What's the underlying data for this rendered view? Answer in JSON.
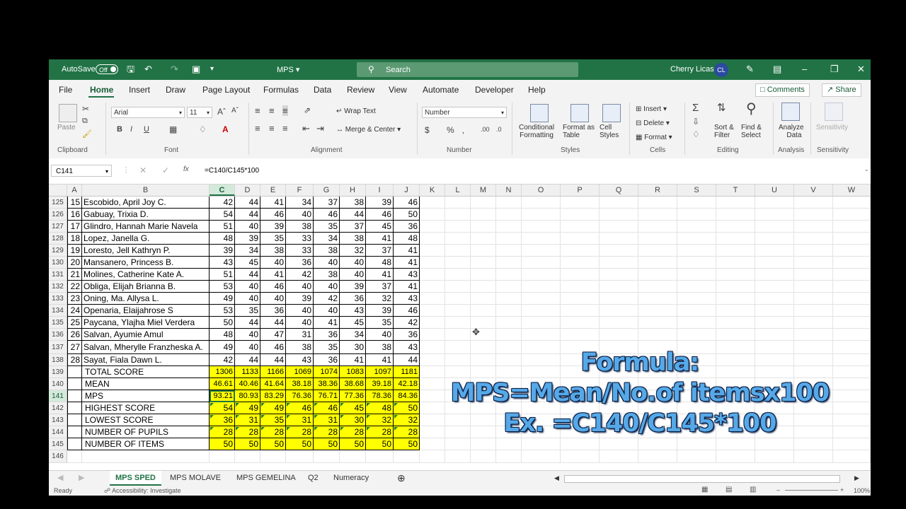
{
  "titlebar": {
    "autosave_label": "AutoSave",
    "autosave_state": "Off",
    "file_name": "MPS",
    "search_placeholder": "Search",
    "user_name": "Cherry Licas",
    "user_initials": "CL",
    "accent_color": "#217346"
  },
  "menu": {
    "items": [
      "File",
      "Home",
      "Insert",
      "Draw",
      "Page Layout",
      "Formulas",
      "Data",
      "Review",
      "View",
      "Automate",
      "Developer",
      "Help"
    ],
    "active": "Home",
    "comments_label": "Comments",
    "share_label": "Share"
  },
  "ribbon": {
    "clipboard": {
      "paste": "Paste",
      "group": "Clipboard"
    },
    "font": {
      "name": "Arial",
      "size": "11",
      "group": "Font"
    },
    "alignment": {
      "wrap_text": "Wrap Text",
      "merge_center": "Merge & Center",
      "group": "Alignment"
    },
    "number": {
      "format": "Number",
      "group": "Number"
    },
    "styles": {
      "conditional_1": "Conditional",
      "conditional_2": "Formatting",
      "format_table_1": "Format as",
      "format_table_2": "Table",
      "cell_styles_1": "Cell",
      "cell_styles_2": "Styles",
      "group": "Styles"
    },
    "cells": {
      "insert": "Insert",
      "delete": "Delete",
      "format": "Format",
      "group": "Cells"
    },
    "editing": {
      "sort_1": "Sort &",
      "sort_2": "Filter",
      "find_1": "Find &",
      "find_2": "Select",
      "group": "Editing"
    },
    "analysis": {
      "analyze_1": "Analyze",
      "analyze_2": "Data",
      "group": "Analysis"
    },
    "sensitivity": {
      "label": "Sensitivity",
      "group": "Sensitivity"
    }
  },
  "formula_bar": {
    "name_box": "C141",
    "fx": "fx",
    "formula": "=C140/C145*100"
  },
  "columns": [
    "A",
    "B",
    "C",
    "D",
    "E",
    "F",
    "G",
    "H",
    "I",
    "J",
    "K",
    "L",
    "M",
    "N",
    "O",
    "P",
    "Q",
    "R",
    "S",
    "T",
    "U",
    "V",
    "W"
  ],
  "selected_column": "C",
  "rows": [
    {
      "r": "125",
      "a": "15",
      "b": "Escobido, April Joy C.",
      "v": [
        "42",
        "44",
        "41",
        "34",
        "37",
        "38",
        "39",
        "46"
      ]
    },
    {
      "r": "126",
      "a": "16",
      "b": "Gabuay, Trixia D.",
      "v": [
        "54",
        "44",
        "46",
        "40",
        "46",
        "44",
        "46",
        "50"
      ]
    },
    {
      "r": "127",
      "a": "17",
      "b": "Glindro, Hannah Marie Navela",
      "v": [
        "51",
        "40",
        "39",
        "38",
        "35",
        "37",
        "45",
        "36"
      ]
    },
    {
      "r": "128",
      "a": "18",
      "b": "Lopez, Janella G.",
      "v": [
        "48",
        "39",
        "35",
        "33",
        "34",
        "38",
        "41",
        "48"
      ]
    },
    {
      "r": "129",
      "a": "19",
      "b": "Loresto, Jell Kathryn P.",
      "v": [
        "39",
        "34",
        "38",
        "33",
        "38",
        "32",
        "37",
        "41"
      ]
    },
    {
      "r": "130",
      "a": "20",
      "b": "Mansanero, Princess B.",
      "v": [
        "43",
        "45",
        "40",
        "36",
        "40",
        "40",
        "48",
        "41"
      ]
    },
    {
      "r": "131",
      "a": "21",
      "b": "Molines, Catherine Kate A.",
      "v": [
        "51",
        "44",
        "41",
        "42",
        "38",
        "40",
        "41",
        "43"
      ]
    },
    {
      "r": "132",
      "a": "22",
      "b": "Obliga, Elijah Brianna B.",
      "v": [
        "53",
        "40",
        "46",
        "40",
        "40",
        "39",
        "37",
        "41"
      ]
    },
    {
      "r": "133",
      "a": "23",
      "b": "Oning, Ma. Allysa L.",
      "v": [
        "49",
        "40",
        "40",
        "39",
        "42",
        "36",
        "32",
        "43"
      ]
    },
    {
      "r": "134",
      "a": "24",
      "b": "Openaria, Elaijahrose S",
      "v": [
        "53",
        "35",
        "36",
        "40",
        "40",
        "43",
        "39",
        "46"
      ]
    },
    {
      "r": "135",
      "a": "25",
      "b": "Paycana, Ylajha Miel Verdera",
      "v": [
        "50",
        "44",
        "44",
        "40",
        "41",
        "45",
        "35",
        "42"
      ]
    },
    {
      "r": "136",
      "a": "26",
      "b": "Salvan, Ayumie Amul",
      "v": [
        "48",
        "40",
        "47",
        "31",
        "36",
        "34",
        "40",
        "36"
      ]
    },
    {
      "r": "137",
      "a": "27",
      "b": "Salvan, Mherylle Franzheska A.",
      "v": [
        "49",
        "40",
        "46",
        "38",
        "35",
        "30",
        "38",
        "43"
      ]
    },
    {
      "r": "138",
      "a": "28",
      "b": "Sayat, Fiala Dawn L.",
      "v": [
        "42",
        "44",
        "44",
        "43",
        "36",
        "41",
        "41",
        "44"
      ]
    },
    {
      "r": "139",
      "a": "",
      "b": "TOTAL SCORE",
      "v": [
        "1306",
        "1133",
        "1166",
        "1069",
        "1074",
        "1083",
        "1097",
        "1181"
      ]
    },
    {
      "r": "140",
      "a": "",
      "b": "MEAN",
      "v": [
        "46.61",
        "40.46",
        "41.64",
        "38.18",
        "38.36",
        "38.68",
        "39.18",
        "42.18"
      ]
    },
    {
      "r": "141",
      "a": "",
      "b": "MPS",
      "v": [
        "93.21",
        "80.93",
        "83.29",
        "76.36",
        "76.71",
        "77.36",
        "78.36",
        "84.36"
      ]
    },
    {
      "r": "142",
      "a": "",
      "b": "HIGHEST SCORE",
      "v": [
        "54",
        "49",
        "49",
        "46",
        "46",
        "45",
        "48",
        "50"
      ]
    },
    {
      "r": "143",
      "a": "",
      "b": "LOWEST SCORE",
      "v": [
        "36",
        "31",
        "35",
        "31",
        "31",
        "30",
        "32",
        "32"
      ]
    },
    {
      "r": "144",
      "a": "",
      "b": "NUMBER OF PUPILS",
      "v": [
        "28",
        "28",
        "28",
        "28",
        "28",
        "28",
        "28",
        "28"
      ]
    },
    {
      "r": "145",
      "a": "",
      "b": "NUMBER OF ITEMS",
      "v": [
        "50",
        "50",
        "50",
        "50",
        "50",
        "50",
        "50",
        "50"
      ]
    },
    {
      "r": "146",
      "a": "",
      "b": "",
      "v": [
        "",
        "",
        "",
        "",
        "",
        "",
        "",
        ""
      ]
    }
  ],
  "annotation": {
    "line1": "Formula:",
    "line2": "MPS=Mean/No.of itemsx100",
    "line3": "Ex. =C140/C145*100"
  },
  "sheet_tabs": [
    "MPS SPED",
    "MPS MOLAVE",
    "MPS GEMELINA",
    "Q2",
    "Numeracy"
  ],
  "active_sheet": "MPS SPED",
  "status": {
    "ready": "Ready",
    "accessibility": "Accessibility: Investigate",
    "zoom": "100%"
  },
  "colors": {
    "summary_fill": "#ffff00",
    "selection": "#217346"
  }
}
